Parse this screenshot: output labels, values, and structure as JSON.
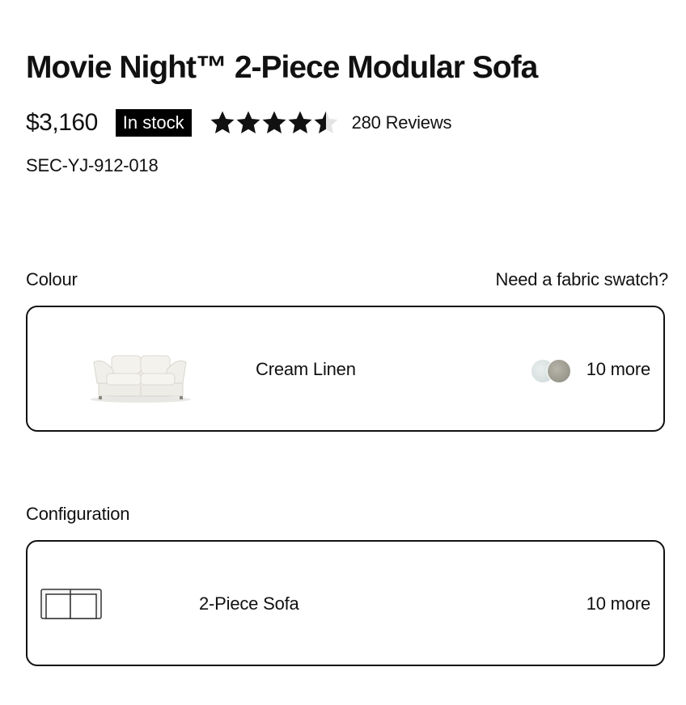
{
  "product": {
    "title": "Movie Night™ 2-Piece Modular Sofa",
    "price": "$3,160",
    "stock_badge": "In stock",
    "rating": 4.5,
    "rating_max": 5,
    "reviews_label": "280 Reviews",
    "sku": "SEC-YJ-912-018"
  },
  "colour": {
    "label": "Colour",
    "swatch_link": "Need a fabric swatch?",
    "selected_name": "Cream Linen",
    "more_label": "10 more",
    "swatch_colors": [
      "#dde4e5",
      "#a3a296"
    ]
  },
  "configuration": {
    "label": "Configuration",
    "selected_name": "2-Piece Sofa",
    "more_label": "10 more"
  },
  "colors": {
    "text": "#111111",
    "badge_bg": "#000000",
    "badge_text": "#ffffff",
    "star_fill": "#111111",
    "star_empty": "#e4e4e4"
  }
}
